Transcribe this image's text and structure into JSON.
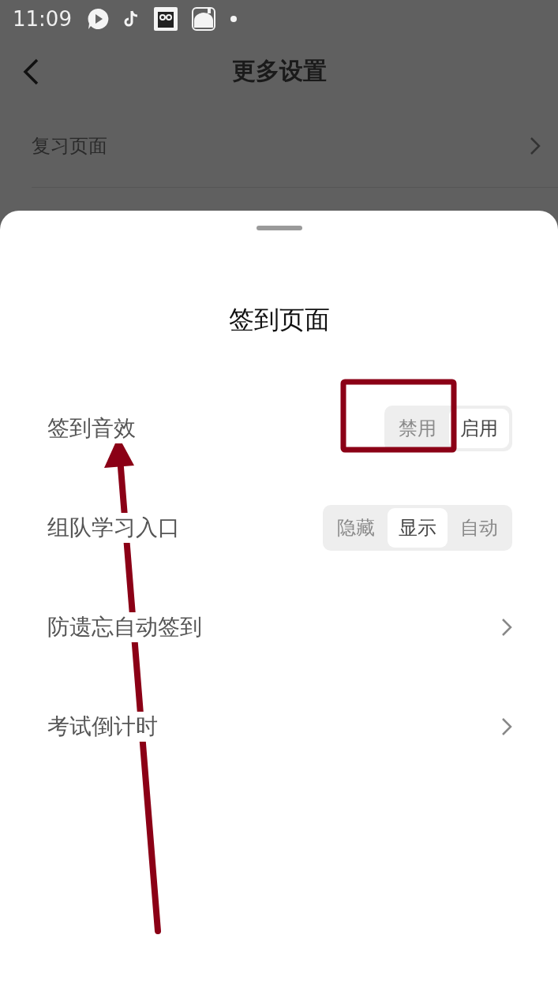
{
  "status_bar": {
    "time": "11:09"
  },
  "header": {
    "title": "更多设置"
  },
  "background_rows": [
    {
      "label": "复习页面"
    }
  ],
  "sheet": {
    "title": "签到页面",
    "rows": [
      {
        "kind": "segmented",
        "label": "签到音效",
        "options": [
          {
            "label": "禁用",
            "selected": false
          },
          {
            "label": "启用",
            "selected": true
          }
        ]
      },
      {
        "kind": "segmented",
        "label": "组队学习入口",
        "options": [
          {
            "label": "隐藏",
            "selected": false
          },
          {
            "label": "显示",
            "selected": true
          },
          {
            "label": "自动",
            "selected": false
          }
        ]
      },
      {
        "kind": "link",
        "label": "防遗忘自动签到"
      },
      {
        "kind": "link",
        "label": "考试倒计时"
      }
    ]
  }
}
